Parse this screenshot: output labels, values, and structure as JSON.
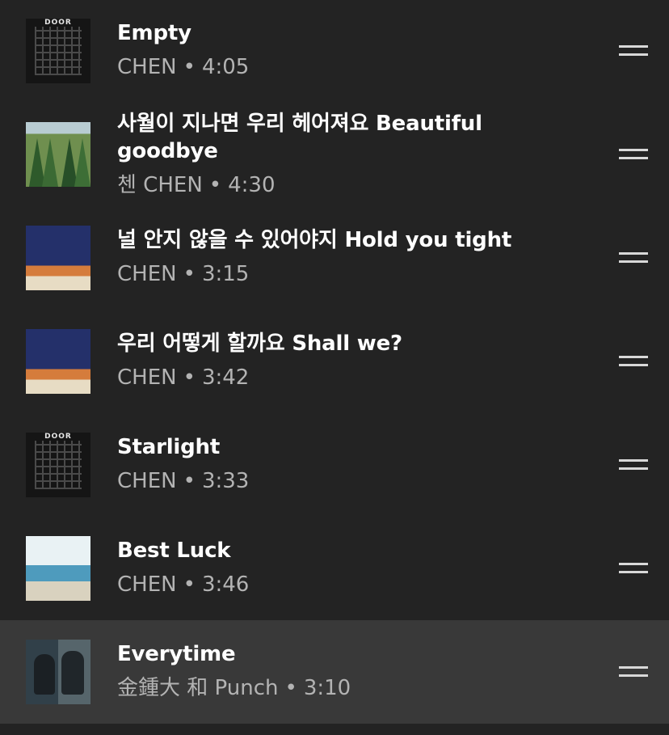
{
  "tracks": [
    {
      "title": "Empty",
      "artist": "CHEN",
      "separator": "•",
      "duration": "4:05",
      "art": "DOOR"
    },
    {
      "title": "사월이 지나면 우리 헤어져요 Beautiful goodbye",
      "artist": "첸 CHEN",
      "separator": "•",
      "duration": "4:30",
      "art": ""
    },
    {
      "title": "널 안지 않을 수 있어야지 Hold you tight",
      "artist": "CHEN",
      "separator": "•",
      "duration": "3:15",
      "art": ""
    },
    {
      "title": "우리 어떻게 할까요 Shall we?",
      "artist": "CHEN",
      "separator": "•",
      "duration": "3:42",
      "art": ""
    },
    {
      "title": "Starlight",
      "artist": "CHEN",
      "separator": "•",
      "duration": "3:33",
      "art": "DOOR"
    },
    {
      "title": "Best Luck",
      "artist": "CHEN",
      "separator": "•",
      "duration": "3:46",
      "art": ""
    },
    {
      "title": "Everytime",
      "artist": "金鍾大 和 Punch",
      "separator": "•",
      "duration": "3:10",
      "art": ""
    }
  ],
  "icons": {
    "reorder": "drag-handle-icon"
  },
  "colors": {
    "background": "#232323",
    "selected_row": "#393939",
    "title": "#ffffff",
    "meta": "#b3b3b3"
  }
}
